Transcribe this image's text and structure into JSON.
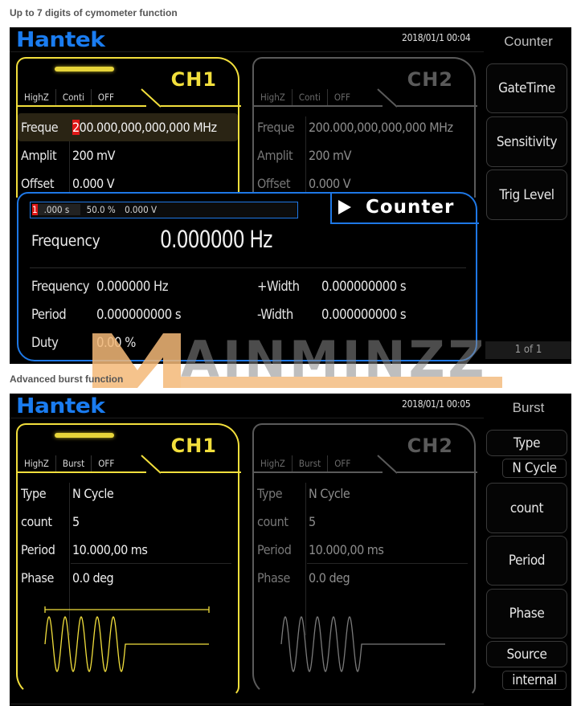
{
  "captions": {
    "counter": "Up to 7 digits of cymometer function",
    "burst": "Advanced burst function"
  },
  "brand": {
    "logo": "Hantek",
    "logo_color": "#1a7cf0",
    "ch1_color": "#f2df3c",
    "ch2_color": "#5a5a5a",
    "counter_accent": "#1e78e6",
    "cursor_color": "#e01818"
  },
  "screen1": {
    "datetime": "2018/01/1 00:04",
    "menu_title": "Counter",
    "ch1": {
      "label": "CH1",
      "tabs": [
        "HighZ",
        "Conti",
        "OFF"
      ],
      "rows": [
        {
          "label": "Freque",
          "value_cursor": "2",
          "value_rest": "00.000,000,000,000 MHz"
        },
        {
          "label": "Amplit",
          "value": "200 mV"
        },
        {
          "label": "Offset",
          "value": "0.000 V"
        }
      ]
    },
    "ch2": {
      "label": "CH2",
      "tabs": [
        "HighZ",
        "Conti",
        "OFF"
      ],
      "rows": [
        {
          "label": "Freque",
          "value": "200.000,000,000,000 MHz"
        },
        {
          "label": "Amplit",
          "value": "200 mV"
        },
        {
          "label": "Offset",
          "value": "0.000 V"
        }
      ]
    },
    "counter": {
      "title": "Counter",
      "settings": {
        "gate_cursor": "1",
        "gate_rest": ".000 s",
        "sensitivity": "50.0 %",
        "trig_level": "0.000 V"
      },
      "main_label": "Frequency",
      "main_value": "0.000000 Hz",
      "measurements": [
        {
          "label": "Frequency",
          "value": "0.000000 Hz"
        },
        {
          "label": "Period",
          "value": "0.000000000 s"
        },
        {
          "label": "Duty",
          "value": "0.00 %"
        },
        {
          "label": "+Width",
          "value": "0.000000000 s"
        },
        {
          "label": "-Width",
          "value": "0.000000000 s"
        }
      ]
    },
    "softkeys": [
      "GateTime",
      "Sensitivity",
      "Trig Level"
    ],
    "pager": "1 of 1"
  },
  "screen2": {
    "datetime": "2018/01/1 00:05",
    "menu_title": "Burst",
    "ch1": {
      "label": "CH1",
      "tabs": [
        "HighZ",
        "Burst",
        "OFF"
      ],
      "rows": [
        {
          "label": "Type",
          "value": "N Cycle"
        },
        {
          "label": "count",
          "value": "5"
        },
        {
          "label": "Period",
          "value": "10.000,00 ms"
        },
        {
          "label": "Phase",
          "value": "0.0 deg"
        }
      ],
      "burst_cycles": 5
    },
    "ch2": {
      "label": "CH2",
      "tabs": [
        "HighZ",
        "Burst",
        "OFF"
      ],
      "rows": [
        {
          "label": "Type",
          "value": "N Cycle"
        },
        {
          "label": "count",
          "value": "5"
        },
        {
          "label": "Period",
          "value": "10.000,00 ms"
        },
        {
          "label": "Phase",
          "value": "0.0 deg"
        }
      ],
      "burst_cycles": 5
    },
    "softkeys": [
      {
        "label": "Type",
        "value": "N Cycle"
      },
      {
        "label": "count"
      },
      {
        "label": "Period"
      },
      {
        "label": "Phase"
      },
      {
        "label": "Source",
        "value": "internal"
      }
    ]
  },
  "watermark": "MAINMINZZ"
}
